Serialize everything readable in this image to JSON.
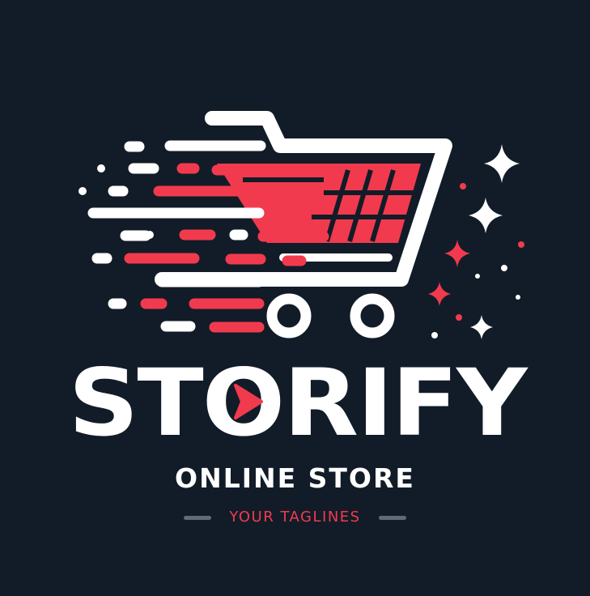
{
  "brand": {
    "name": "STORIFY",
    "name_before": "ST",
    "name_o": "O",
    "name_after": "RIFY",
    "subtitle": "ONLINE STORE",
    "tagline": "YOUR TAGLINES"
  },
  "colors": {
    "background": "#121c28",
    "primary": "#ffffff",
    "accent": "#f23a4e",
    "muted": "#5f6b78"
  },
  "icons": {
    "cart": "shopping-cart-icon",
    "play": "play-arrow-icon",
    "sparkle": "sparkle-icon"
  }
}
